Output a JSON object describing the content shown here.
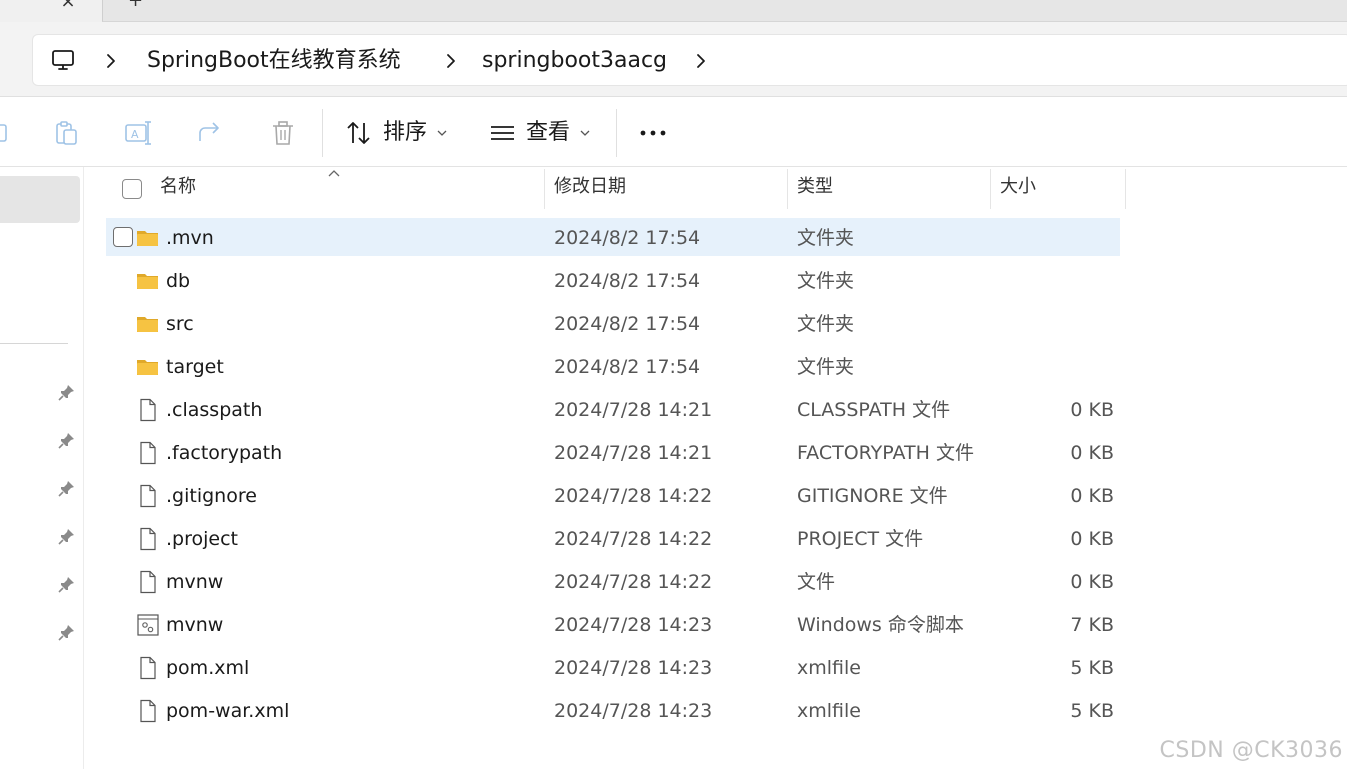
{
  "tabs": {
    "close_glyph": "×",
    "new_glyph": "+"
  },
  "breadcrumb": {
    "root_icon": "monitor-icon",
    "items": [
      "SpringBoot在线教育系统",
      "springboot3aacg"
    ]
  },
  "toolbar": {
    "icons": [
      "copy-icon",
      "paste-icon",
      "rename-icon",
      "share-icon",
      "delete-icon"
    ],
    "sort_label": "排序",
    "view_label": "查看",
    "more_icon": "more-dots-icon"
  },
  "sidebar": {
    "pinned_count": 6,
    "pin_icon": "pin-icon"
  },
  "columns": {
    "name": "名称",
    "modified": "修改日期",
    "type": "类型",
    "size": "大小"
  },
  "files": [
    {
      "name": ".mvn",
      "modified": "2024/8/2 17:54",
      "type": "文件夹",
      "size": "",
      "icon": "folder-icon",
      "selected": true
    },
    {
      "name": "db",
      "modified": "2024/8/2 17:54",
      "type": "文件夹",
      "size": "",
      "icon": "folder-icon"
    },
    {
      "name": "src",
      "modified": "2024/8/2 17:54",
      "type": "文件夹",
      "size": "",
      "icon": "folder-icon"
    },
    {
      "name": "target",
      "modified": "2024/8/2 17:54",
      "type": "文件夹",
      "size": "",
      "icon": "folder-icon"
    },
    {
      "name": ".classpath",
      "modified": "2024/7/28 14:21",
      "type": "CLASSPATH 文件",
      "size": "0 KB",
      "icon": "file-icon"
    },
    {
      "name": ".factorypath",
      "modified": "2024/7/28 14:21",
      "type": "FACTORYPATH 文件",
      "size": "0 KB",
      "icon": "file-icon"
    },
    {
      "name": ".gitignore",
      "modified": "2024/7/28 14:22",
      "type": "GITIGNORE 文件",
      "size": "0 KB",
      "icon": "file-icon"
    },
    {
      "name": ".project",
      "modified": "2024/7/28 14:22",
      "type": "PROJECT 文件",
      "size": "0 KB",
      "icon": "file-icon"
    },
    {
      "name": "mvnw",
      "modified": "2024/7/28 14:22",
      "type": "文件",
      "size": "0 KB",
      "icon": "file-icon"
    },
    {
      "name": "mvnw",
      "modified": "2024/7/28 14:23",
      "type": "Windows 命令脚本",
      "size": "7 KB",
      "icon": "script-file-icon"
    },
    {
      "name": "pom.xml",
      "modified": "2024/7/28 14:23",
      "type": "xmlfile",
      "size": "5 KB",
      "icon": "file-icon"
    },
    {
      "name": "pom-war.xml",
      "modified": "2024/7/28 14:23",
      "type": "xmlfile",
      "size": "5 KB",
      "icon": "file-icon"
    }
  ],
  "watermark": "CSDN @CK3036",
  "colors": {
    "selection": "#e6f1fb",
    "folder": "#f6c342",
    "folder_dark": "#e0a92a",
    "accent": "#0067c0"
  }
}
